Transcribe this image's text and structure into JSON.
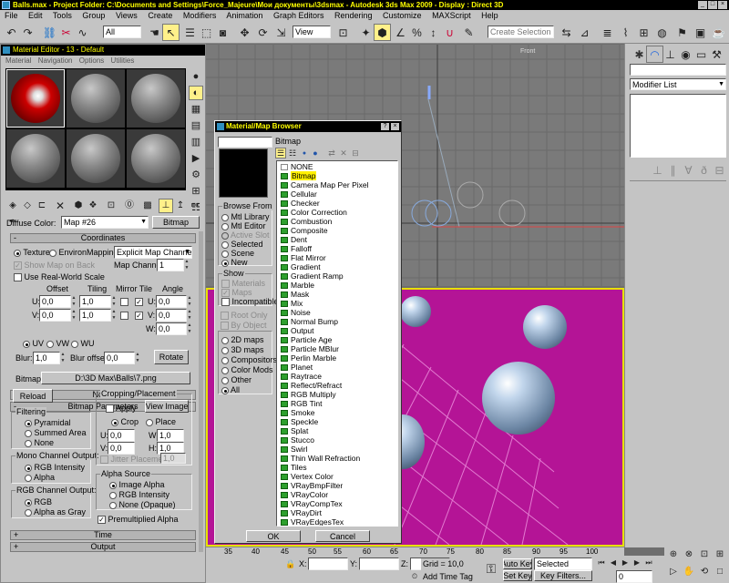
{
  "title_bar": {
    "text": "Balls.max    - Project Folder: C:\\Documents and Settings\\Force_Majeure\\Мои документы\\3dsmax    - Autodesk 3ds Max  2009        - Display : Direct 3D",
    "controls": [
      "_",
      "□",
      "×"
    ]
  },
  "menu": {
    "items": [
      "File",
      "Edit",
      "Tools",
      "Group",
      "Views",
      "Create",
      "Modifiers",
      "Animation",
      "Graph Editors",
      "Rendering",
      "Customize",
      "MAXScript",
      "Help"
    ]
  },
  "toolbar": {
    "selection_filter": "All",
    "reference_coord": "View",
    "named_selection_placeholder": "Create Selection Set"
  },
  "material_editor": {
    "title": "Material Editor - 13 - Default",
    "menu": [
      "Material",
      "Navigation",
      "Options",
      "Utilities"
    ],
    "diffuse_label": "Diffuse Color:",
    "map_name": "Map #26",
    "map_type": "Bitmap",
    "coordinates": {
      "rollout": "Coordinates",
      "texture": "Texture",
      "environ": "Environ",
      "mapping_label": "Mapping:",
      "mapping_value": "Explicit Map Channel",
      "show_map_on_back": "Show Map on Back",
      "map_channel_label": "Map Channel:",
      "map_channel_value": "1",
      "use_real_world": "Use Real-World Scale",
      "col_offset": "Offset",
      "col_tiling": "Tiling",
      "col_mirror_tile": "Mirror Tile",
      "col_angle": "Angle",
      "u_label": "U:",
      "v_label": "V:",
      "w_label": "W:",
      "u_offset": "0,0",
      "v_offset": "0,0",
      "u_tiling": "1,0",
      "v_tiling": "1,0",
      "u_angle": "0,0",
      "v_angle": "0,0",
      "w_angle": "0,0",
      "uv": "UV",
      "vw": "VW",
      "wu": "WU",
      "blur_label": "Blur:",
      "blur_value": "1,0",
      "blur_offset_label": "Blur offset:",
      "blur_offset_value": "0,0",
      "rotate": "Rotate"
    },
    "noise_rollout": "Noise",
    "bitmap_rollout": "Bitmap Parameters",
    "bitmap_label": "Bitmap:",
    "bitmap_path": "D:\\3D Max\\Balls\\7.png",
    "reload": "Reload",
    "filtering": {
      "title": "Filtering",
      "options": [
        "Pyramidal",
        "Summed Area",
        "None"
      ]
    },
    "mono_output": {
      "title": "Mono Channel Output:",
      "options": [
        "RGB Intensity",
        "Alpha"
      ]
    },
    "rgb_output": {
      "title": "RGB Channel Output:",
      "options": [
        "RGB",
        "Alpha as Gray"
      ]
    },
    "cropping": {
      "title": "Cropping/Placement",
      "apply": "Apply",
      "view_image": "View Image",
      "crop": "Crop",
      "place": "Place",
      "u_label": "U:",
      "v_label": "V:",
      "w_label": "W:",
      "h_label": "H:",
      "u": "0,0",
      "v": "0,0",
      "w": "1,0",
      "h": "1,0",
      "jitter_label": "Jitter Placement:",
      "jitter_value": "1,0"
    },
    "alpha_source": {
      "title": "Alpha Source",
      "options": [
        "Image Alpha",
        "RGB Intensity",
        "None (Opaque)"
      ]
    },
    "premultiplied": "Premultiplied Alpha",
    "time_rollout": "Time",
    "output_rollout": "Output"
  },
  "browser": {
    "title": "Material/Map Browser",
    "title_buttons": [
      "?",
      "×"
    ],
    "current": "Bitmap",
    "browse_from": {
      "title": "Browse From",
      "options": [
        "Mtl Library",
        "Mtl Editor",
        "Active Slot",
        "Selected",
        "Scene",
        "New"
      ]
    },
    "show": {
      "title": "Show",
      "options": [
        "Materials",
        "Maps",
        "Incompatible"
      ]
    },
    "root_only": "Root Only",
    "by_object": "By Object",
    "categories": [
      "2D maps",
      "3D maps",
      "Compositors",
      "Color Mods",
      "Other",
      "All"
    ],
    "maps": [
      "NONE",
      "Bitmap",
      "Camera Map Per Pixel",
      "Cellular",
      "Checker",
      "Color Correction",
      "Combustion",
      "Composite",
      "Dent",
      "Falloff",
      "Flat Mirror",
      "Gradient",
      "Gradient Ramp",
      "Marble",
      "Mask",
      "Mix",
      "Noise",
      "Normal Bump",
      "Output",
      "Particle Age",
      "Particle MBlur",
      "Perlin Marble",
      "Planet",
      "Raytrace",
      "Reflect/Refract",
      "RGB Multiply",
      "RGB Tint",
      "Smoke",
      "Speckle",
      "Splat",
      "Stucco",
      "Swirl",
      "Thin Wall Refraction",
      "Tiles",
      "Vertex Color",
      "VRayBmpFilter",
      "VRayColor",
      "VRayCompTex",
      "VRayDirt",
      "VRayEdgesTex"
    ],
    "ok": "OK",
    "cancel": "Cancel"
  },
  "viewports": {
    "top_label": "Front"
  },
  "command_panel": {
    "modifier_list": "Modifier List"
  },
  "timeline": {
    "ticks": [
      "35",
      "40",
      "45",
      "50",
      "55",
      "60",
      "65",
      "70",
      "75",
      "80",
      "85",
      "90",
      "95",
      "100"
    ]
  },
  "status": {
    "x_label": "X:",
    "y_label": "Y:",
    "z_label": "Z:",
    "grid": "Grid = 10,0",
    "add_time_tag": "Add Time Tag",
    "auto_key": "Auto Key",
    "set_key": "Set Key",
    "selected": "Selected",
    "key_filters": "Key Filters...",
    "frame": "0"
  },
  "colors": {
    "window_bg": "#c4c4c4",
    "title_bg": "#000000",
    "title_text": "#ffff00",
    "viewport_bg": "#7a7a7a",
    "render_bg": "#b41496",
    "highlight": "#fff000"
  }
}
